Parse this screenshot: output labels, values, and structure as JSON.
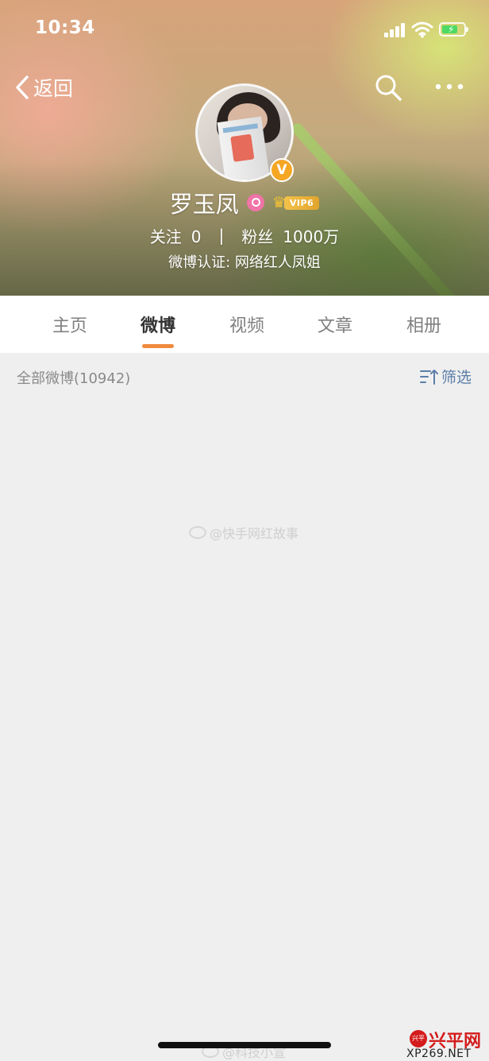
{
  "status_bar": {
    "time": "10:34"
  },
  "nav": {
    "back_label": "返回"
  },
  "profile": {
    "name": "罗玉凤",
    "vip_level": "VIP6",
    "following_label": "关注",
    "following_count": "0",
    "separator": "|",
    "followers_label": "粉丝",
    "followers_count": "1000万",
    "verification": "微博认证: 网络红人凤姐"
  },
  "tabs": [
    {
      "label": "主页"
    },
    {
      "label": "微博"
    },
    {
      "label": "视频"
    },
    {
      "label": "文章"
    },
    {
      "label": "相册"
    }
  ],
  "active_tab": "微博",
  "feed": {
    "all_label": "全部微博(10942)",
    "filter_label": "筛选"
  },
  "watermarks": {
    "center": "@快手网红故事",
    "bottom": "@科技小宣"
  },
  "site_logo": {
    "seal_text": "兴平",
    "brand": "兴平网",
    "url": "XP269.NET"
  },
  "colors": {
    "accent": "#f08a3e",
    "filter_blue": "#5b7ea8",
    "vip_gold": "#f3c24b",
    "member_pink": "#ef74a7",
    "verified_orange": "#f5a623",
    "page_bg": "#efefef"
  },
  "icons": {
    "back": "chevron-left-icon",
    "search": "search-icon",
    "more": "more-dots-icon",
    "verified": "verified-v-icon",
    "member": "member-icon",
    "vip": "crown-icon",
    "filter": "filter-sort-icon",
    "signal": "cellular-signal-icon",
    "wifi": "wifi-icon",
    "battery": "battery-charging-icon"
  }
}
